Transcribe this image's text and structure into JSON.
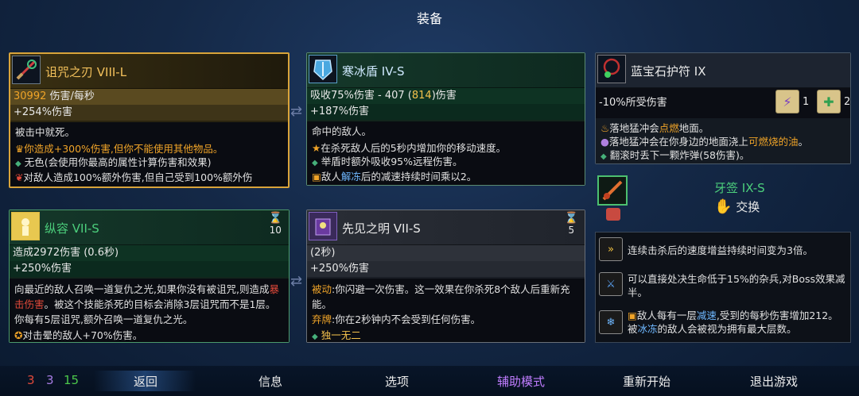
{
  "title": "装备",
  "cards": {
    "curse": {
      "name": "诅咒之刃 VIII-L",
      "dmg_value": "30992",
      "dmg_text": " 伤害/每秒",
      "pct": "+254%伤害",
      "line1": "被击中就死。",
      "line2": "你造成+300%伤害,但你不能使用其他物品。",
      "line3": "无色(会使用你最高的属性计算伤害和效果)",
      "line4": "对敌人造成100%额外伤害,但自己受到100%额外伤"
    },
    "shield": {
      "name": "寒冰盾 IV-S",
      "absorb_a": "吸收75%伤害 - 407 (",
      "absorb_b": "814",
      "absorb_c": ")伤害",
      "pct": "+187%伤害",
      "line1": "命中的敌人。",
      "line2": "在杀死敌人后的5秒内增加你的移动速度。",
      "line3": "举盾时额外吸收95%远程伤害。",
      "line4a": "敌人",
      "line4b": "解冻",
      "line4c": "后的减速持续时间乘以2。"
    },
    "amulet": {
      "name": "蓝宝石护符 IX",
      "stat": "-10%所受伤害",
      "scroll1": "1",
      "scroll2": "2",
      "line1a": "落地猛冲会",
      "line1b": "点燃",
      "line1c": "地面。",
      "line2a": "落地猛冲会在你身边的地面浇上",
      "line2b": "可燃烧的油",
      "line2c": "。",
      "line3": "翻滚时丢下一颗炸弹(58伤害)。"
    },
    "fang": {
      "name": "牙签 IX-S",
      "swap": "交换",
      "m1": "连续击杀后的速度增益持续时间变为3倍。",
      "m2": "可以直接处决生命低于15%的杂兵,对Boss效果减半。",
      "m3a": "敌人每有一层",
      "m3b": "减速",
      "m3c": ",受到的每秒伤害增加212。被",
      "m3d": "冰冻",
      "m3e": "的敌人会被视为拥有最大层数。"
    },
    "indulge": {
      "name": "纵容 VII-S",
      "cooldown": "10",
      "dmg": "造成2972伤害 (0.6秒)",
      "pct": "+250%伤害",
      "body_a": "向最近的敌人召唤一道复仇之光,如果你没有被诅咒,则造成",
      "body_b": "暴击伤害",
      "body_c": "。被这个技能杀死的目标会消除3层诅咒而不是1层。你每有5层诅咒,额外召唤一道复仇之光。",
      "foot": "对击晕的敌人+70%伤害。"
    },
    "foresight": {
      "name": "先见之明 VII-S",
      "cooldown": "5",
      "dur": "(2秒)",
      "pct": "+250%伤害",
      "p1a": "被动",
      "p1b": ":你闪避一次伤害。这一效果在你杀死8个敌人后重新充能。",
      "p2a": "弃牌",
      "p2b": ":你在2秒钟内不会受到任何伤害。",
      "foot": "独一无二"
    }
  },
  "bar": {
    "s1": "3",
    "s2": "3",
    "s3": "15",
    "back": "返回",
    "info": "信息",
    "options": "选项",
    "assist": "辅助模式",
    "restart": "重新开始",
    "quit": "退出游戏"
  },
  "colors": {
    "brutality": "#e0493a",
    "tactics": "#a77ce3",
    "survival": "#4cc84b",
    "legendary": "#f0b43a",
    "assist": "#c07dff"
  }
}
